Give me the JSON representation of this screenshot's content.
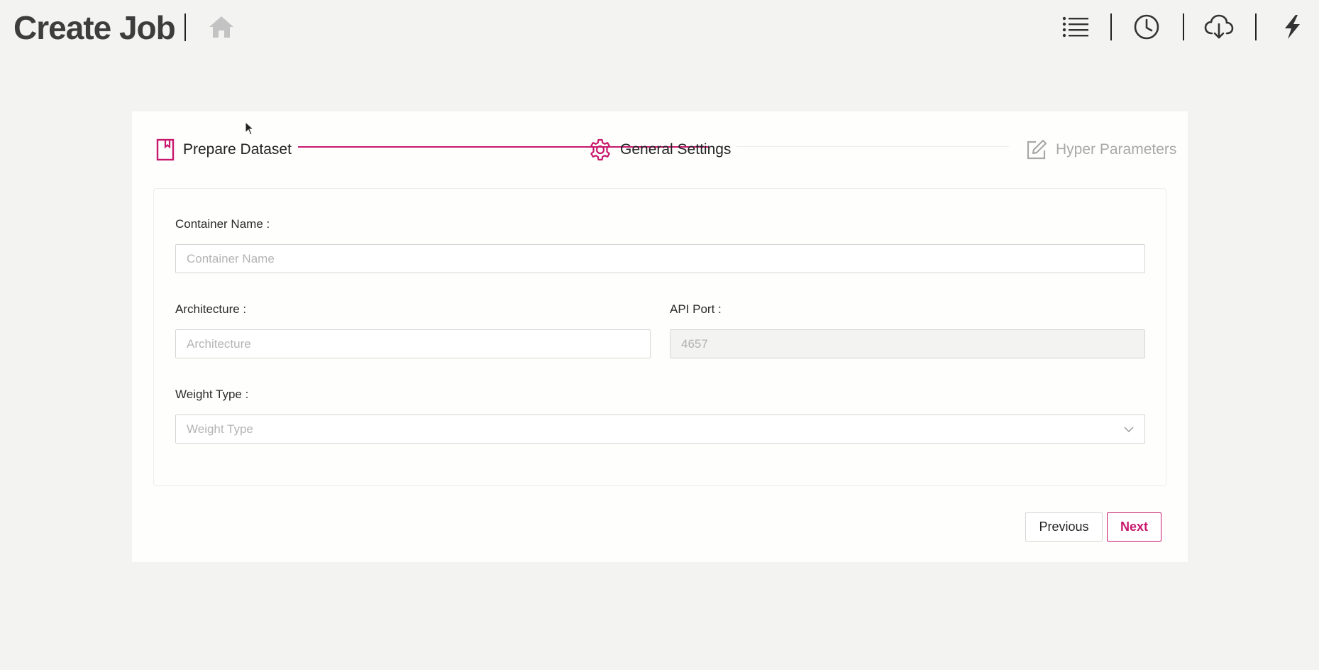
{
  "header": {
    "title": "Create Job",
    "home_icon": "home-icon",
    "tools": [
      {
        "name": "list-icon"
      },
      {
        "name": "clock-icon"
      },
      {
        "name": "cloud-download-icon"
      },
      {
        "name": "lightning-icon"
      }
    ]
  },
  "steps": [
    {
      "label": "Prepare Dataset",
      "icon": "bookmark-icon",
      "state": "done"
    },
    {
      "label": "General Settings",
      "icon": "gear-icon",
      "state": "active"
    },
    {
      "label": "Hyper Parameters",
      "icon": "edit-icon",
      "state": "pending"
    }
  ],
  "form": {
    "container_name": {
      "label": "Container Name :",
      "placeholder": "Container Name"
    },
    "architecture": {
      "label": "Architecture :",
      "placeholder": "Architecture"
    },
    "api_port": {
      "label": "API Port :",
      "value": "4657"
    },
    "weight_type": {
      "label": "Weight Type :",
      "placeholder": "Weight Type"
    }
  },
  "buttons": {
    "previous": "Previous",
    "next": "Next"
  },
  "colors": {
    "accent": "#c8186e",
    "background": "#f3f4f2",
    "card": "#fefefc",
    "inactive": "#a8a8a8"
  }
}
